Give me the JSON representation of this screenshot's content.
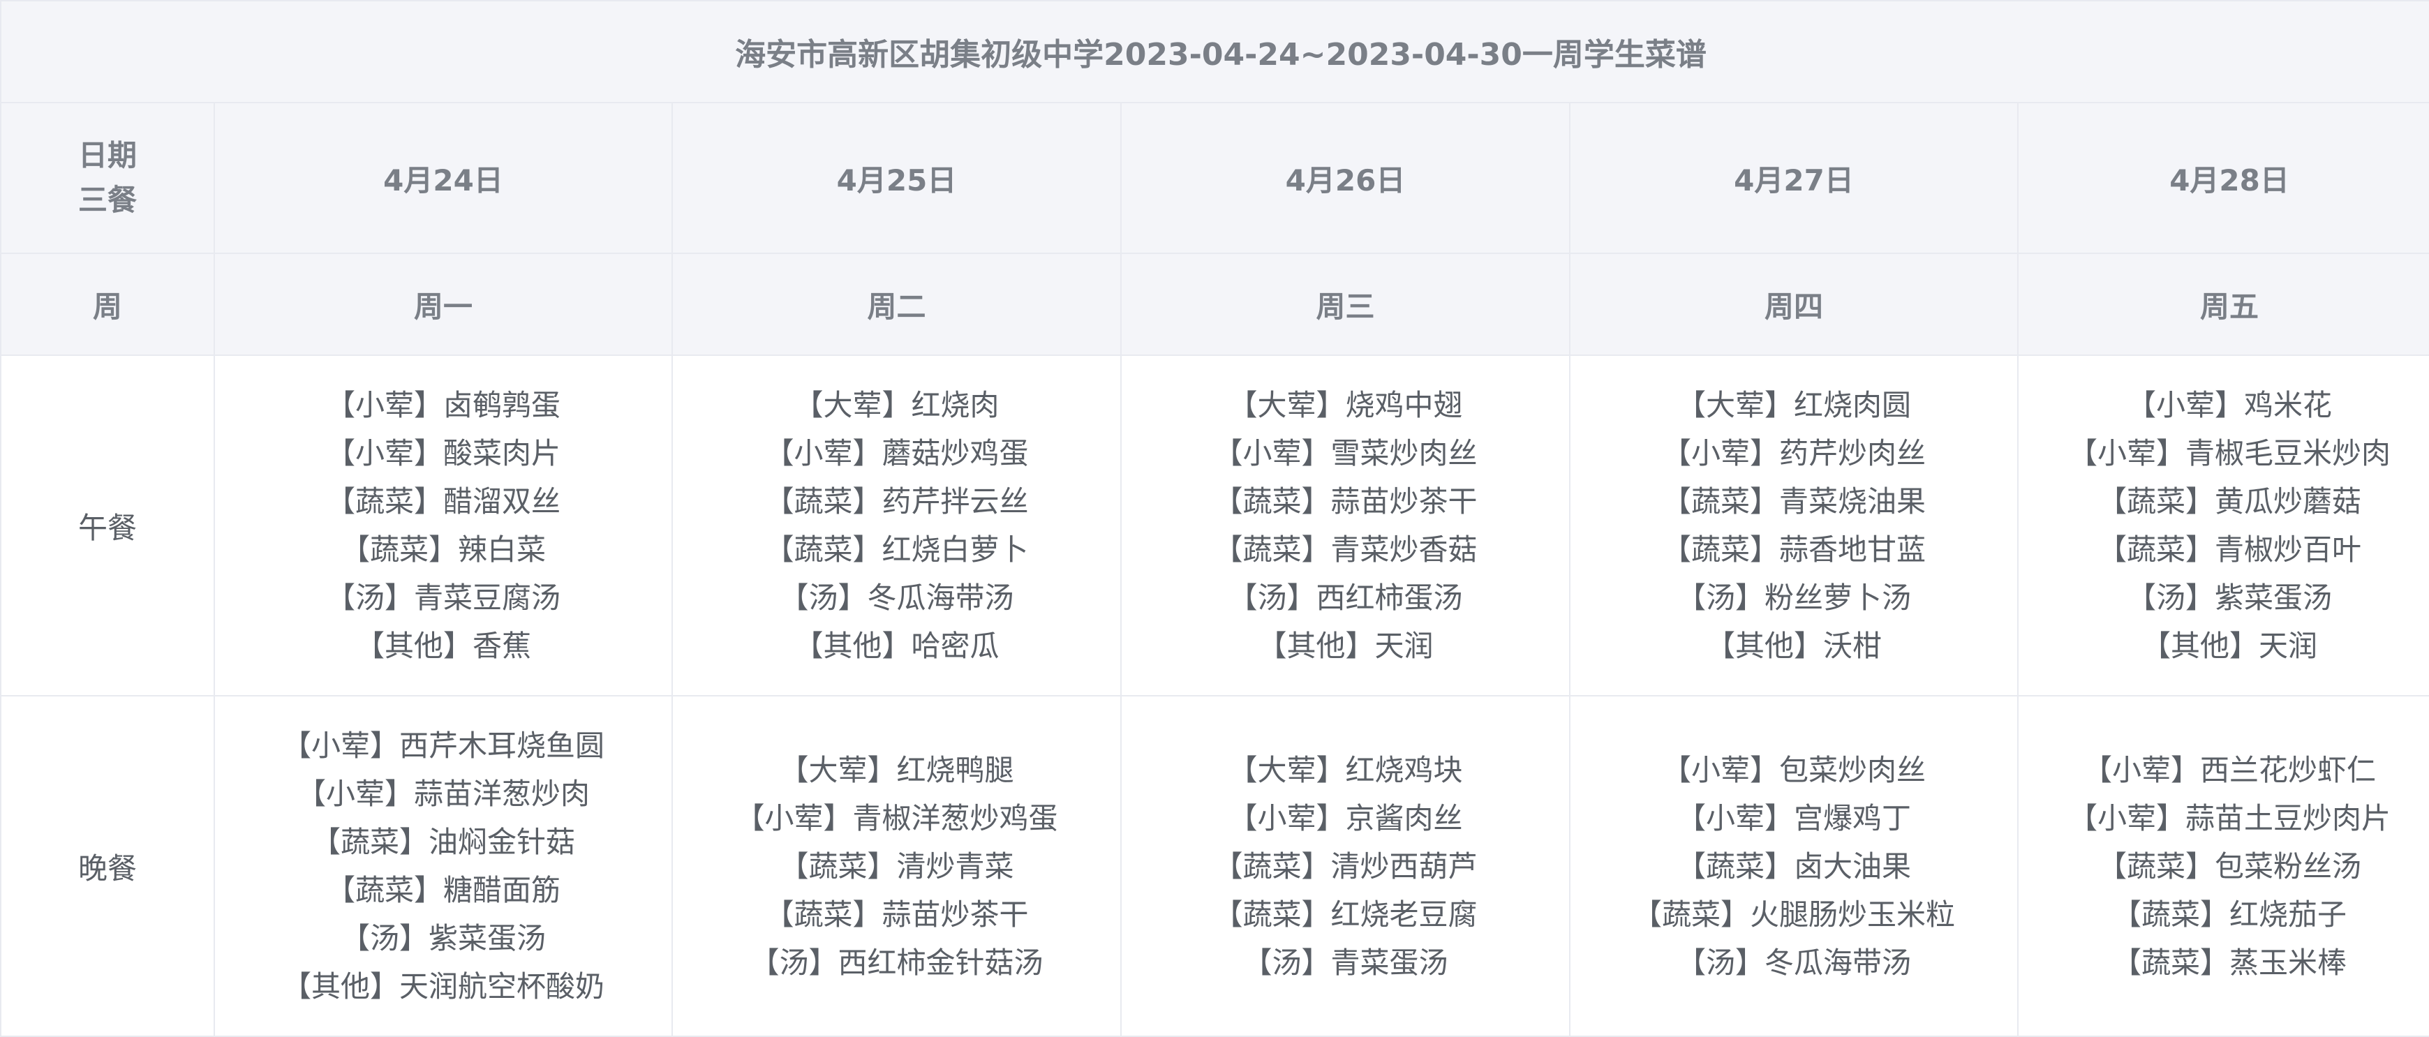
{
  "title": "海安市高新区胡集初级中学2023-04-24~2023-04-30一周学生菜谱",
  "header": {
    "date_label_1": "日期",
    "date_label_2": "三餐",
    "week_label": "周"
  },
  "days": [
    {
      "date": "4月24日",
      "weekday": "周一"
    },
    {
      "date": "4月25日",
      "weekday": "周二"
    },
    {
      "date": "4月26日",
      "weekday": "周三"
    },
    {
      "date": "4月27日",
      "weekday": "周四"
    },
    {
      "date": "4月28日",
      "weekday": "周五"
    }
  ],
  "meals": [
    {
      "name": "午餐",
      "dishes": [
        [
          "【小荤】卤鹌鹑蛋",
          "【小荤】酸菜肉片",
          "【蔬菜】醋溜双丝",
          "【蔬菜】辣白菜",
          "【汤】青菜豆腐汤",
          "【其他】香蕉"
        ],
        [
          "【大荤】红烧肉",
          "【小荤】蘑菇炒鸡蛋",
          "【蔬菜】药芹拌云丝",
          "【蔬菜】红烧白萝卜",
          "【汤】冬瓜海带汤",
          "【其他】哈密瓜"
        ],
        [
          "【大荤】烧鸡中翅",
          "【小荤】雪菜炒肉丝",
          "【蔬菜】蒜苗炒茶干",
          "【蔬菜】青菜炒香菇",
          "【汤】西红柿蛋汤",
          "【其他】天润"
        ],
        [
          "【大荤】红烧肉圆",
          "【小荤】药芹炒肉丝",
          "【蔬菜】青菜烧油果",
          "【蔬菜】蒜香地甘蓝",
          "【汤】粉丝萝卜汤",
          "【其他】沃柑"
        ],
        [
          "【小荤】鸡米花",
          "【小荤】青椒毛豆米炒肉",
          "【蔬菜】黄瓜炒蘑菇",
          "【蔬菜】青椒炒百叶",
          "【汤】紫菜蛋汤",
          "【其他】天润"
        ]
      ]
    },
    {
      "name": "晚餐",
      "dishes": [
        [
          "【小荤】西芹木耳烧鱼圆",
          "【小荤】蒜苗洋葱炒肉",
          "【蔬菜】油焖金针菇",
          "【蔬菜】糖醋面筋",
          "【汤】紫菜蛋汤",
          "【其他】天润航空杯酸奶"
        ],
        [
          "【大荤】红烧鸭腿",
          "【小荤】青椒洋葱炒鸡蛋",
          "【蔬菜】清炒青菜",
          "【蔬菜】蒜苗炒茶干",
          "【汤】西红柿金针菇汤"
        ],
        [
          "【大荤】红烧鸡块",
          "【小荤】京酱肉丝",
          "【蔬菜】清炒西葫芦",
          "【蔬菜】红烧老豆腐",
          "【汤】青菜蛋汤"
        ],
        [
          "【小荤】包菜炒肉丝",
          "【小荤】宫爆鸡丁",
          "【蔬菜】卤大油果",
          "【蔬菜】火腿肠炒玉米粒",
          "【汤】冬瓜海带汤"
        ],
        [
          "【小荤】西兰花炒虾仁",
          "【小荤】蒜苗土豆炒肉片",
          "【蔬菜】包菜粉丝汤",
          "【蔬菜】红烧茄子",
          "【蔬菜】蒸玉米棒"
        ]
      ]
    }
  ]
}
